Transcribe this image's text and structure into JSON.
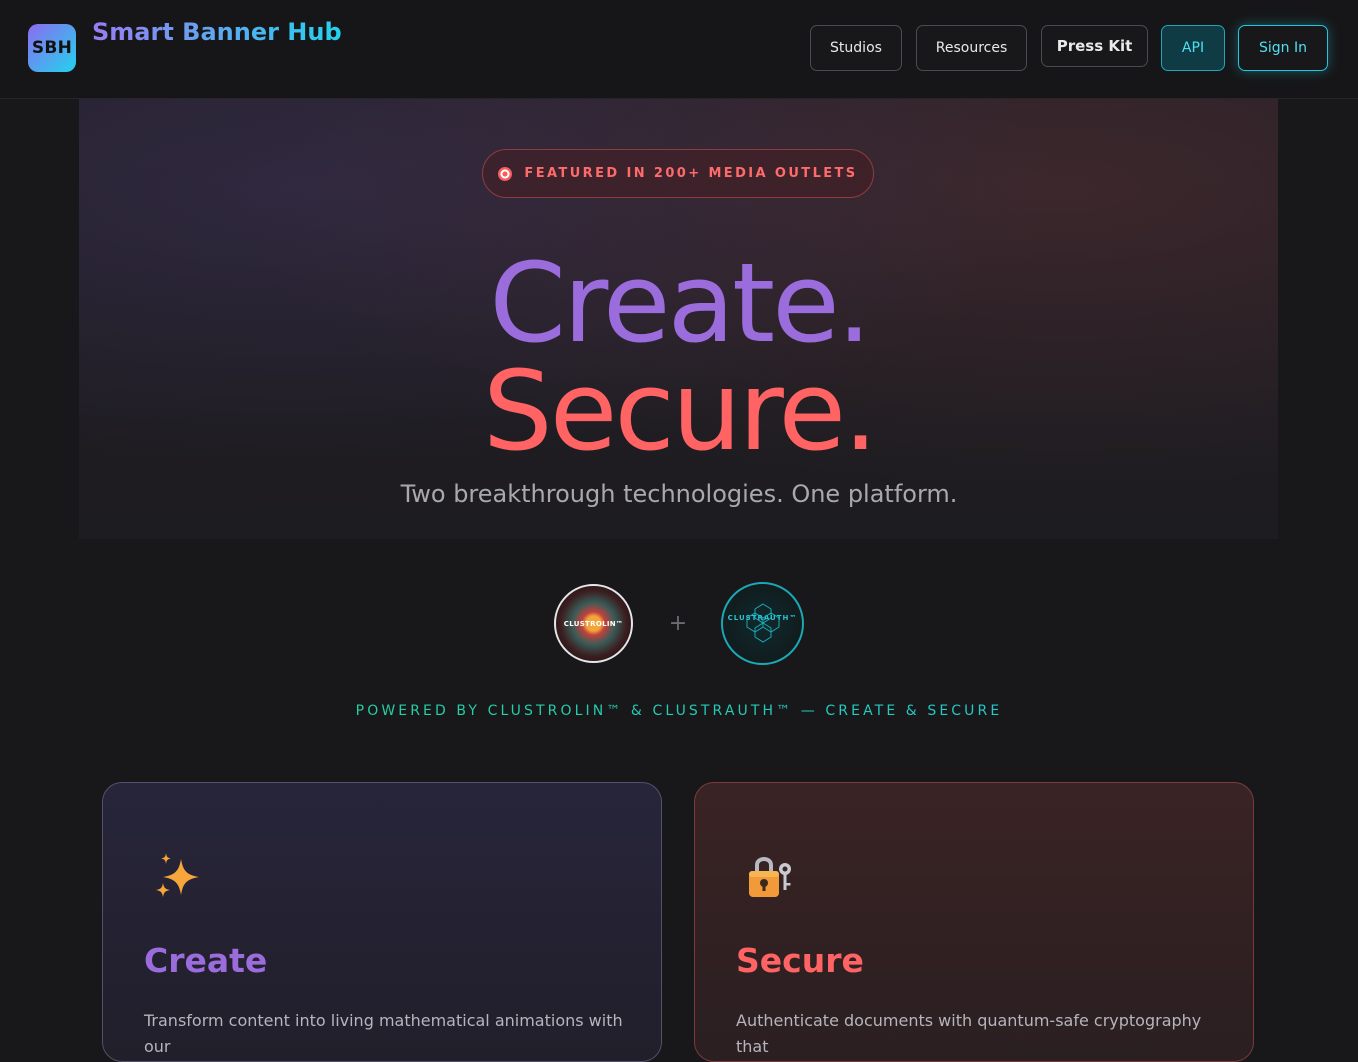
{
  "header": {
    "logo_text": "SBH",
    "brand": "Smart Banner Hub",
    "nav": {
      "studios": "Studios",
      "resources": "Resources",
      "press_kit": "Press Kit",
      "api": "API",
      "sign_in": "Sign In"
    }
  },
  "hero": {
    "badge": "FEATURED IN 200+ MEDIA OUTLETS",
    "badge_icon": "target-icon",
    "headline_1": "Create.",
    "headline_2": "Secure.",
    "subtitle": "Two breakthrough technologies. One platform."
  },
  "tech": {
    "logo_1": "CLUSTROLIN™",
    "logo_2": "CLUSTRAUTH™",
    "plus": "+",
    "powered": "POWERED BY CLUSTROLIN™ & CLUSTRAUTH™ — CREATE & SECURE"
  },
  "cards": [
    {
      "icon": "sparkles-icon",
      "title": "Create",
      "text": "Transform content into living mathematical animations with our"
    },
    {
      "icon": "lock-with-key-icon",
      "title": "Secure",
      "text": "Authenticate documents with quantum-safe cryptography that"
    }
  ],
  "colors": {
    "create_accent": "#9b6cdc",
    "secure_accent": "#ff6363",
    "cyan_accent": "#22d3ee",
    "green_accent": "#25d48a"
  }
}
